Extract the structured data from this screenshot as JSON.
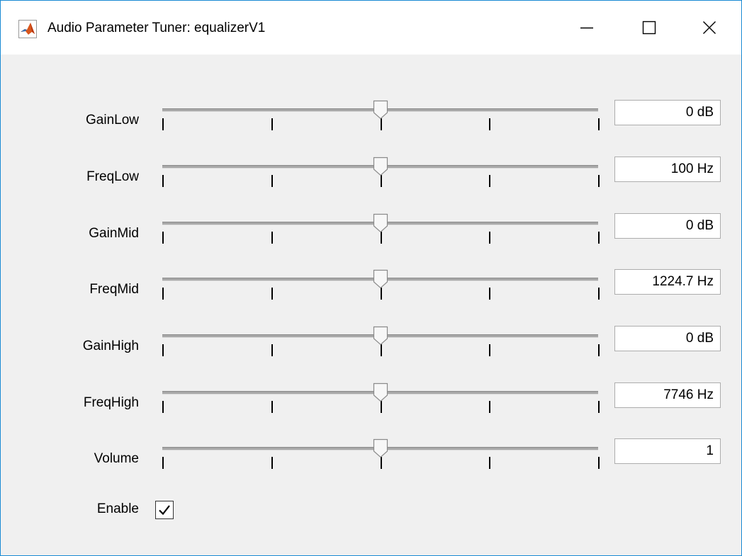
{
  "window": {
    "title": "Audio Parameter Tuner: equalizerV1",
    "icon": "matlab-icon",
    "controls": {
      "minimize": "minimize-icon",
      "maximize": "maximize-icon",
      "close": "close-icon"
    }
  },
  "parameters": [
    {
      "label": "GainLow",
      "value": "0 dB",
      "slider_position": 0.5
    },
    {
      "label": "FreqLow",
      "value": "100 Hz",
      "slider_position": 0.5
    },
    {
      "label": "GainMid",
      "value": "0 dB",
      "slider_position": 0.5
    },
    {
      "label": "FreqMid",
      "value": "1224.7 Hz",
      "slider_position": 0.5
    },
    {
      "label": "GainHigh",
      "value": "0 dB",
      "slider_position": 0.5
    },
    {
      "label": "FreqHigh",
      "value": "7746 Hz",
      "slider_position": 0.5
    },
    {
      "label": "Volume",
      "value": "1",
      "slider_position": 0.5
    }
  ],
  "enable": {
    "label": "Enable",
    "checked": true
  },
  "colors": {
    "window_border": "#1a8ad4",
    "background": "#f0f0f0",
    "titlebar": "#ffffff"
  }
}
